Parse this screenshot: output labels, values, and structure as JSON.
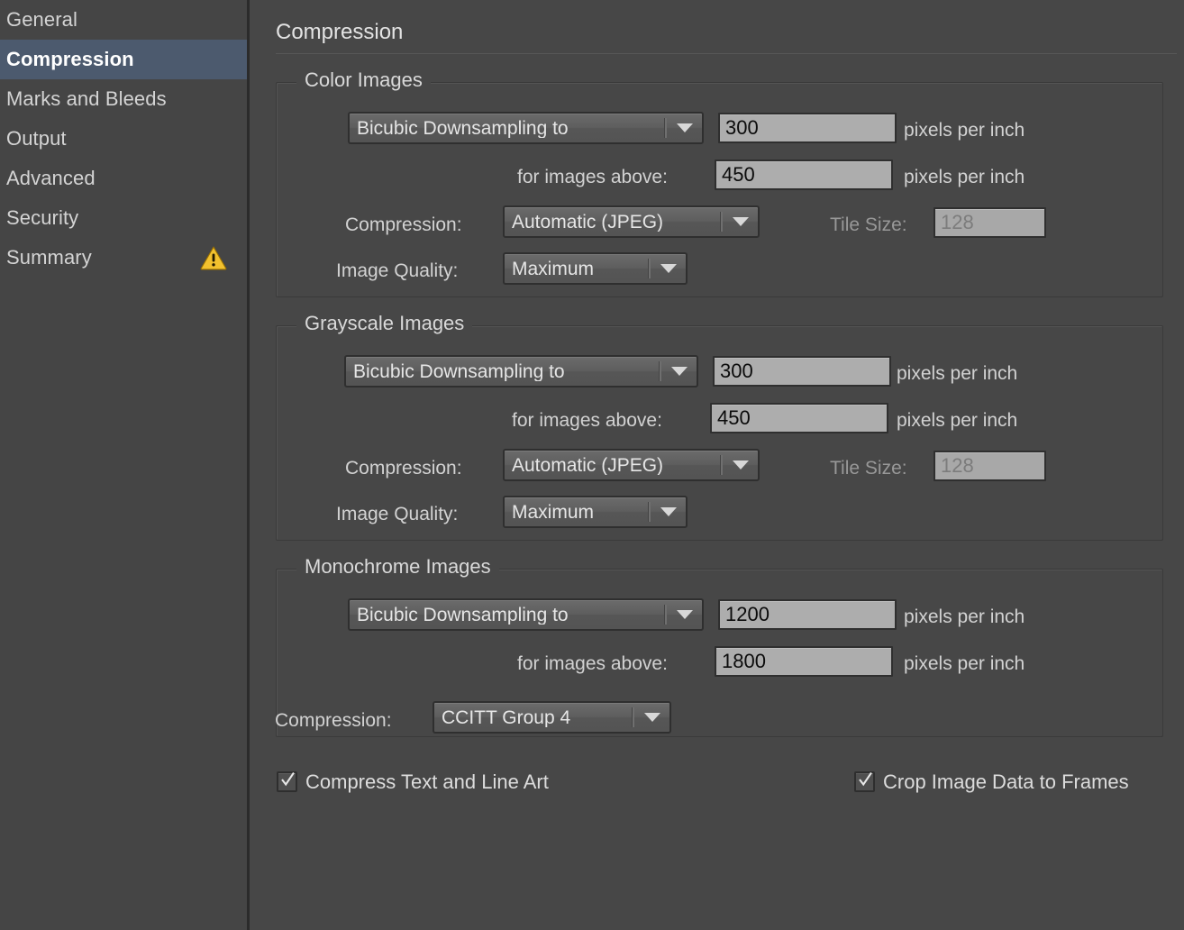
{
  "sidebar": {
    "items": [
      {
        "label": "General",
        "selected": false,
        "warning": false
      },
      {
        "label": "Compression",
        "selected": true,
        "warning": false
      },
      {
        "label": "Marks and Bleeds",
        "selected": false,
        "warning": false
      },
      {
        "label": "Output",
        "selected": false,
        "warning": false
      },
      {
        "label": "Advanced",
        "selected": false,
        "warning": false
      },
      {
        "label": "Security",
        "selected": false,
        "warning": false
      },
      {
        "label": "Summary",
        "selected": false,
        "warning": true
      }
    ],
    "warning_icon": "warning-triangle-icon",
    "selected_color": "#4c5a6e"
  },
  "main": {
    "title": "Compression"
  },
  "color_images": {
    "legend": "Color Images",
    "downsample_method": "Bicubic Downsampling to",
    "downsample_dpi": "300",
    "downsample_unit": "pixels per inch",
    "threshold_label": "for images above:",
    "threshold_dpi": "450",
    "threshold_unit": "pixels per inch",
    "compression_label": "Compression:",
    "compression_value": "Automatic (JPEG)",
    "tile_size_label": "Tile Size:",
    "tile_size_value": "128",
    "tile_size_enabled": false,
    "quality_label": "Image Quality:",
    "quality_value": "Maximum"
  },
  "grayscale_images": {
    "legend": "Grayscale Images",
    "downsample_method": "Bicubic Downsampling to",
    "downsample_dpi": "300",
    "downsample_unit": "pixels per inch",
    "threshold_label": "for images above:",
    "threshold_dpi": "450",
    "threshold_unit": "pixels per inch",
    "compression_label": "Compression:",
    "compression_value": "Automatic (JPEG)",
    "tile_size_label": "Tile Size:",
    "tile_size_value": "128",
    "tile_size_enabled": false,
    "quality_label": "Image Quality:",
    "quality_value": "Maximum"
  },
  "monochrome_images": {
    "legend": "Monochrome Images",
    "downsample_method": "Bicubic Downsampling to",
    "downsample_dpi": "1200",
    "downsample_unit": "pixels per inch",
    "threshold_label": "for images above:",
    "threshold_dpi": "1800",
    "threshold_unit": "pixels per inch",
    "compression_label": "Compression:",
    "compression_value": "CCITT Group 4"
  },
  "options": {
    "compress_text": {
      "label": "Compress Text and Line Art",
      "checked": true
    },
    "crop_image_data": {
      "label": "Crop Image Data to Frames",
      "checked": true
    }
  },
  "colors": {
    "window_bg": "#474747",
    "sidebar_bg": "#454545",
    "selection": "#4c5a6e",
    "field_bg": "#adadad",
    "warning_yellow": "#f2c12e"
  }
}
